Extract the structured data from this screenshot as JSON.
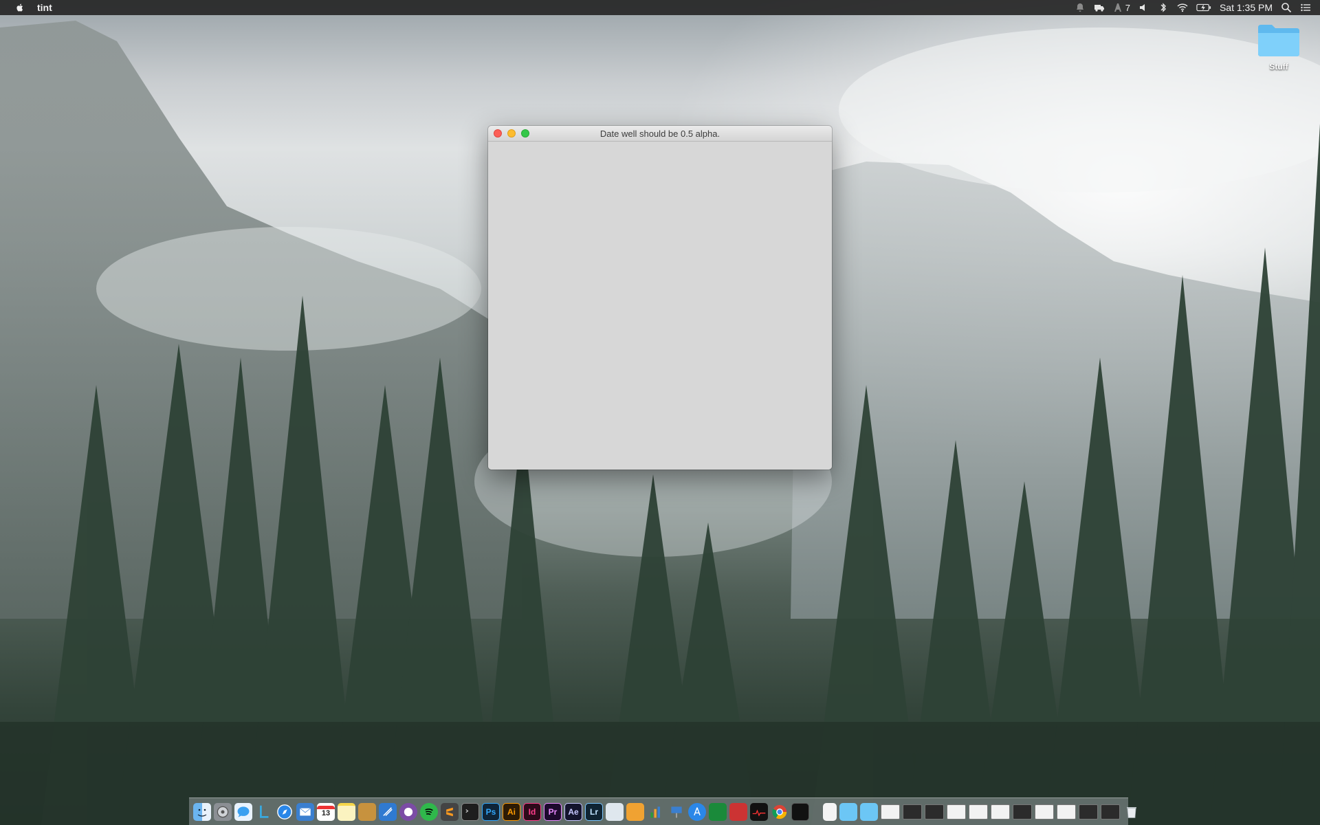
{
  "menubar": {
    "app_name": "tint",
    "clock": "Sat 1:35 PM",
    "notification_count": "7",
    "icons": [
      "apple-icon",
      "notifications-icon",
      "delivery-icon",
      "text-app-icon",
      "volume-icon",
      "bluetooth-icon",
      "wifi-icon",
      "battery-icon",
      "spotlight-icon",
      "notification-center-icon"
    ]
  },
  "desktop": {
    "folder_label": "Stuff"
  },
  "window": {
    "title": "Date well should be 0.5 alpha."
  },
  "dock": {
    "app_labels": {
      "photoshop": "Ps",
      "illustrator": "Ai",
      "indesign": "Id",
      "premiere": "Pr",
      "after_effects": "Ae",
      "lightroom": "Lr"
    },
    "badges": {
      "calendar_day": "13"
    }
  },
  "colors": {
    "close": "#fc5f57",
    "minimize": "#fdbc2e",
    "zoom": "#33c748",
    "window_bg": "#d7d7d7",
    "folder": "#6cc6f5"
  }
}
